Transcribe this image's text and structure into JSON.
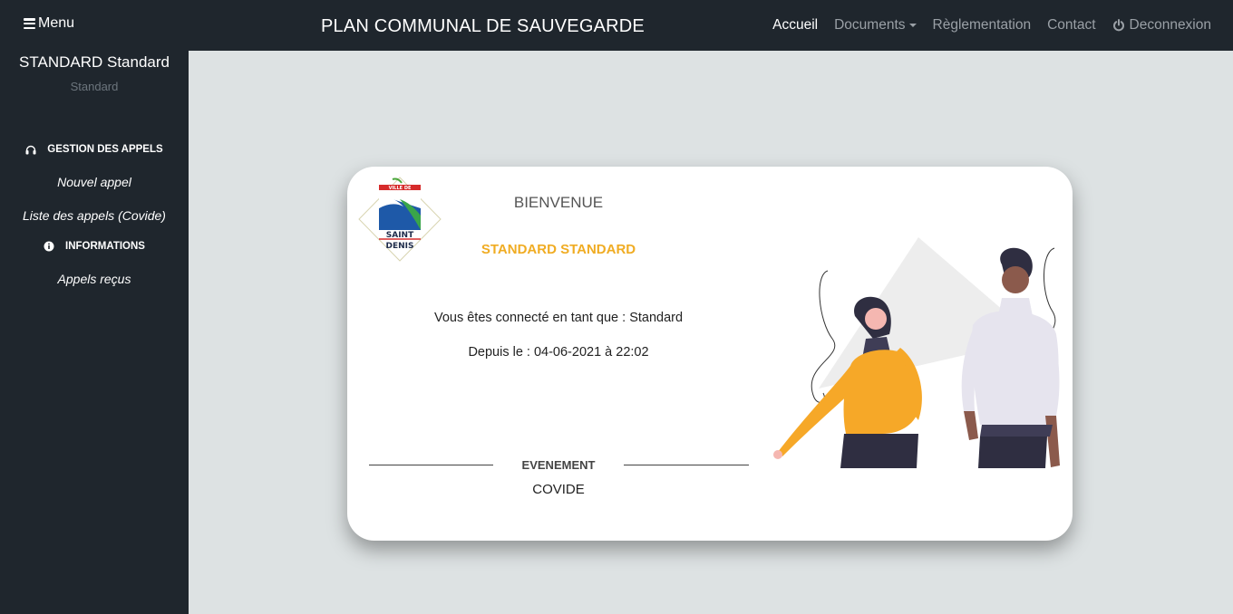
{
  "navbar": {
    "menu_label": "Menu",
    "brand": "PLAN COMMUNAL DE SAUVEGARDE",
    "links": [
      {
        "label": "Accueil",
        "active": true
      },
      {
        "label": "Documents"
      },
      {
        "label": "Règlementation"
      },
      {
        "label": "Contact"
      },
      {
        "label": "Deconnexion"
      }
    ]
  },
  "sidebar": {
    "user_name": "STANDARD Standard",
    "user_role": "Standard",
    "section_calls": "GESTION DES APPELS",
    "item_new_call": "Nouvel appel",
    "item_call_list": "Liste des appels (Covide)",
    "section_info": "INFORMATIONS",
    "item_received": "Appels reçus"
  },
  "card": {
    "logo_top": "VILLE DE",
    "logo_line1": "SAINT",
    "logo_line2": "DENIS",
    "welcome": "BIENVENUE",
    "user": "STANDARD STANDARD",
    "connected_as": "Vous êtes connecté en tant que : Standard",
    "since": "Depuis le : 04-06-2021 à 22:02",
    "event_label": "EVENEMENT",
    "event_value": "COVIDE"
  },
  "colors": {
    "dark": "#1f262d",
    "background": "#dde2e3",
    "accent": "#f0ac23",
    "muted": "#9aa0a6"
  },
  "icons": {
    "menu": "hamburger-icon",
    "documents_caret": "caret-down-icon",
    "logout": "power-icon",
    "calls": "headphones-icon",
    "info": "info-circle-icon"
  }
}
